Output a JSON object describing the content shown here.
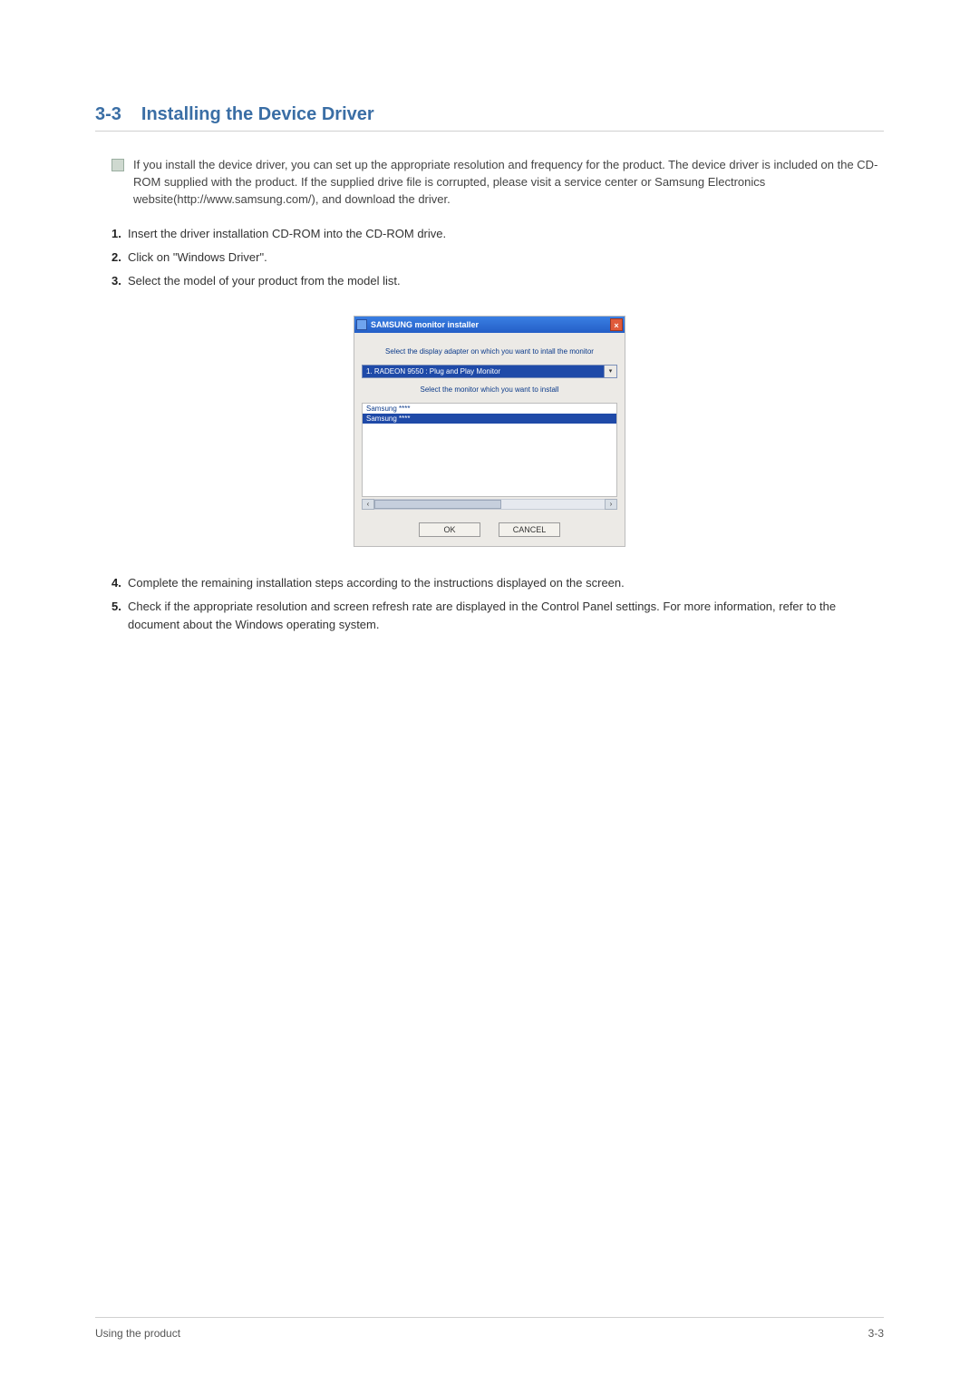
{
  "section": {
    "number": "3-3",
    "title": "Installing the Device Driver"
  },
  "note": "If you install the device driver, you can set up the appropriate resolution and frequency for the product. The device driver is included on the CD-ROM supplied with the product. If the supplied drive file is corrupted, please visit a service center or Samsung Electronics website(http://www.samsung.com/), and download the driver.",
  "steps": [
    "Insert the driver installation CD-ROM into the CD-ROM drive.",
    "Click on \"Windows Driver\".",
    "Select the model of your product from the model list.",
    "Complete the remaining installation steps according to the instructions displayed on the screen.",
    "Check if the appropriate resolution and screen refresh rate are displayed in the Control Panel settings. For more information, refer to the document about the Windows operating system."
  ],
  "installer": {
    "windowTitle": "SAMSUNG monitor installer",
    "closeGlyph": "×",
    "prompt1": "Select the display adapter on which you want to intall the monitor",
    "adapterSelected": "1. RADEON 9550 : Plug and Play Monitor",
    "dropdownGlyph": "▾",
    "prompt2": "Select the monitor which you want to install",
    "listItems": [
      "Samsung ****",
      "Samsung ****"
    ],
    "scrollLeft": "‹",
    "scrollRight": "›",
    "okLabel": "OK",
    "cancelLabel": "CANCEL"
  },
  "footer": {
    "left": "Using the product",
    "right": "3-3"
  }
}
